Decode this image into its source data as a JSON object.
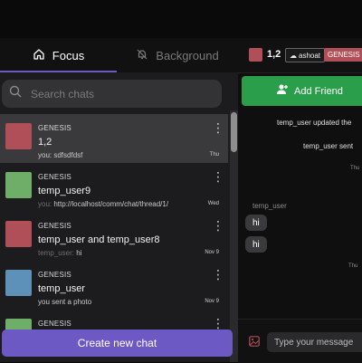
{
  "tabs": {
    "focus": "Focus",
    "background": "Background"
  },
  "search": {
    "placeholder": "Search chats"
  },
  "chats": [
    {
      "community": "GENESIS",
      "title": "1,2",
      "you_prefix": "you: ",
      "preview": "sdfsdfdsf",
      "time": "Thu",
      "avatar_color": "#b04f58"
    },
    {
      "community": "GENESIS",
      "title": "temp_user9",
      "you_prefix": "you: ",
      "preview": "http://localhost/comm/chat/thread/1/",
      "time": "Wed",
      "avatar_color": "#6fae68"
    },
    {
      "community": "GENESIS",
      "title": "temp_user and temp_user8",
      "you_prefix": "temp_user: ",
      "preview": "hi",
      "time": "Nov 9",
      "avatar_color": "#b04f58"
    },
    {
      "community": "GENESIS",
      "title": "temp_user",
      "you_prefix": "",
      "preview": "you sent a photo",
      "time": "Nov 9",
      "avatar_color": "#5d91b8"
    },
    {
      "community": "GENESIS",
      "title": "",
      "you_prefix": "",
      "preview": "",
      "time": "",
      "avatar_color": "#6fae68"
    }
  ],
  "create_chat": "Create new chat",
  "thread": {
    "name": "1,2",
    "user_badge": "ashoat",
    "community_badge": "GENESIS",
    "add_friend": "Add Friend",
    "system1": "temp_user updated the",
    "system2": "temp_user sent",
    "stamp1": "Thu",
    "sender": "temp_user",
    "bubbles": [
      "hi",
      "hi"
    ],
    "stamp2": "Thu",
    "composer_placeholder": "Type your message"
  },
  "colors": {
    "accent": "#6d59c4",
    "add_friend": "#2b9e4c",
    "genesis": "#b04f58"
  }
}
